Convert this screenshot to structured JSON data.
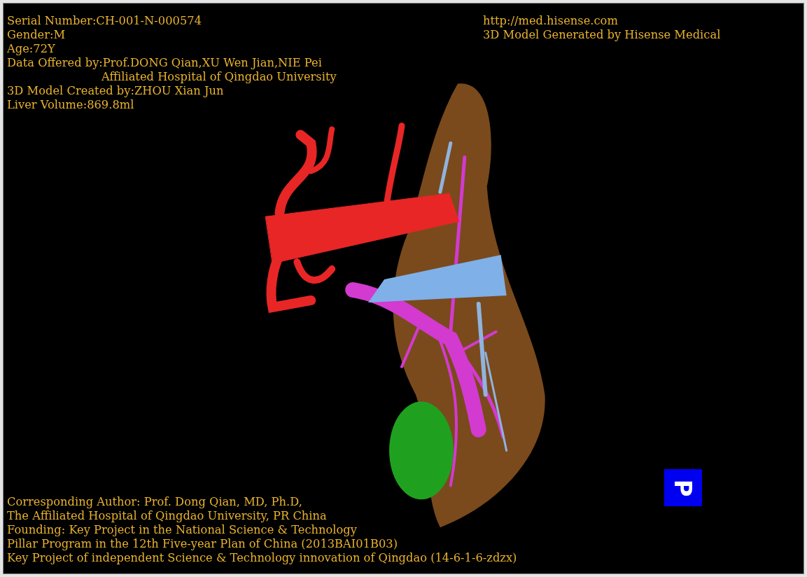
{
  "patient_info": [
    {
      "text": "Serial Number:CH-001-N-000574",
      "kind": "line"
    },
    {
      "text": "Gender:M",
      "kind": "line"
    },
    {
      "text": "Age:72Y",
      "kind": "line"
    },
    {
      "text": "Data Offered by:Prof.DONG Qian,XU Wen Jian,NIE Pei",
      "kind": "line"
    },
    {
      "text": "Affiliated Hospital of Qingdao University",
      "kind": "continuation"
    },
    {
      "text": "3D Model Created by:ZHOU Xian Jun",
      "kind": "line"
    },
    {
      "text": "Liver Volume:869.8ml",
      "kind": "line"
    }
  ],
  "producer_info": [
    "http://med.hisense.com",
    "3D Model Generated by Hisense Medical"
  ],
  "credits": [
    "Corresponding Author: Prof. Dong Qian, MD, Ph.D,",
    "The Affiliated Hospital of Qingdao University, PR China",
    "Founding: Key Project in the National Science & Technology",
    "Pillar Program in the 12th Five-year Plan of China (2013BAI01B03)",
    "Key Project of independent Science & Technology innovation of Qingdao (14-6-1-6-zdzx)"
  ],
  "orientation_marker": {
    "label": "P"
  }
}
